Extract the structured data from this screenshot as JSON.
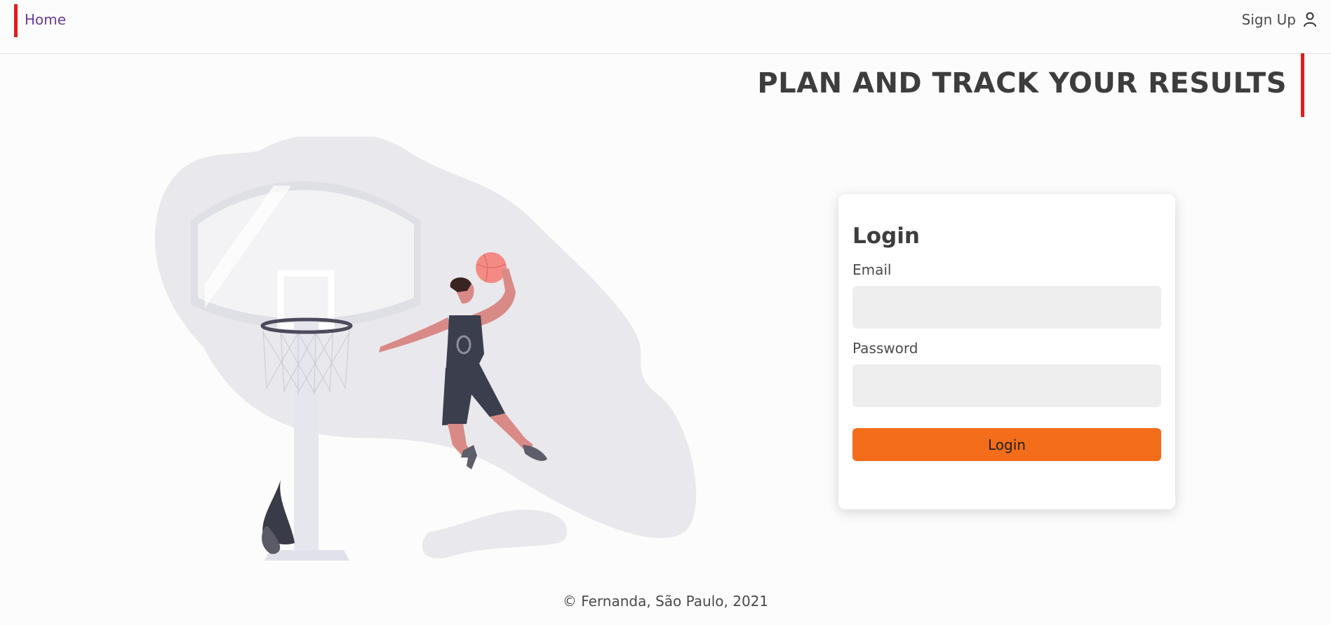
{
  "nav": {
    "home_label": "Home",
    "signup_label": "Sign Up",
    "signup_icon": "user-icon"
  },
  "hero": {
    "headline": "PLAN AND TRACK YOUR RESULTS",
    "illustration": "basketball-player-dunking"
  },
  "login": {
    "title": "Login",
    "email_label": "Email",
    "email_value": "",
    "email_placeholder": "",
    "password_label": "Password",
    "password_value": "",
    "password_placeholder": "",
    "submit_label": "Login"
  },
  "footer": {
    "text": "© Fernanda, São Paulo, 2021"
  },
  "colors": {
    "accent_red": "#e11b1b",
    "button_orange": "#f46d1a",
    "link_purple": "#6b3b9a"
  }
}
